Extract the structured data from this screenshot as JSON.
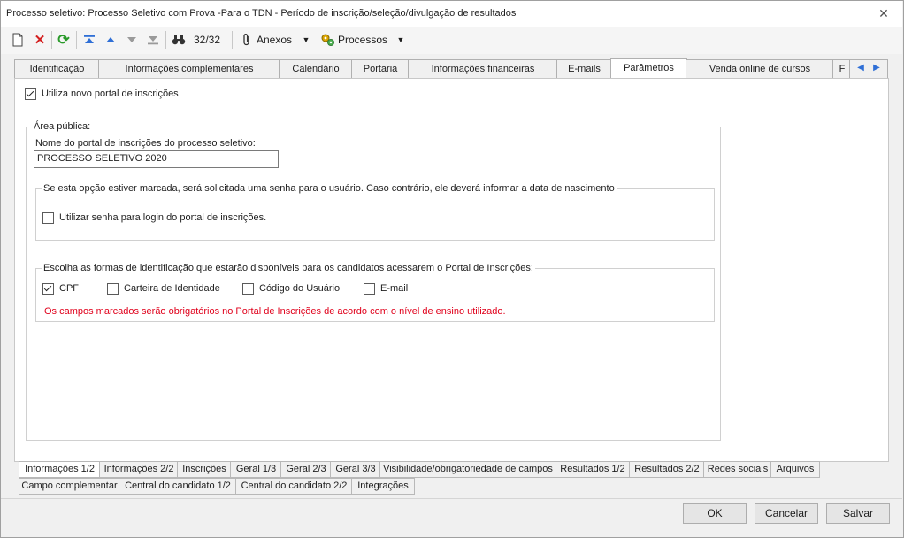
{
  "window": {
    "title": "Processo seletivo: Processo Seletivo com Prova -Para o TDN - Período de inscrição/seleção/divulgação de resultados",
    "close_icon": "close-icon"
  },
  "toolbar": {
    "record_counter": "32/32",
    "attachments_label": "Anexos",
    "processes_label": "Processos"
  },
  "top_tabs": [
    "Identificação",
    "Informações complementares",
    "Calendário",
    "Portaria",
    "Informações financeiras",
    "E-mails",
    "Parâmetros",
    "Venda online de cursos",
    "F"
  ],
  "content": {
    "use_new_portal_label": "Utiliza novo portal de inscrições",
    "public_area_legend": "Área pública:",
    "portal_name_label": "Nome do portal de inscrições do processo seletivo:",
    "portal_name_value": "PROCESSO SELETIVO 2020",
    "password_group_legend": "Se esta opção estiver marcada, será solicitada uma senha para o usuário. Caso contrário, ele deverá informar a data de nascimento",
    "use_password_label": "Utilizar senha para login do portal de inscrições.",
    "id_group_legend": "Escolha as formas de identificação que estarão disponíveis para os candidatos acessarem o Portal de Inscrições:",
    "id_options": [
      "CPF",
      "Carteira de Identidade",
      "Código do Usuário",
      "E-mail"
    ],
    "warning": "Os campos marcados serão obrigatórios no Portal de Inscrições de acordo com o nível de ensino utilizado.",
    "warning_color": "#e0001b"
  },
  "bottom_tabs_row1": [
    "Informações 1/2",
    "Informações 2/2",
    "Inscrições",
    "Geral 1/3",
    "Geral 2/3",
    "Geral 3/3",
    "Visibilidade/obrigatoriedade de campos",
    "Resultados 1/2",
    "Resultados 2/2",
    "Redes sociais",
    "Arquivos"
  ],
  "bottom_tabs_row2": [
    "Campo complementar",
    "Central do candidato 1/2",
    "Central do candidato 2/2",
    "Integrações"
  ],
  "buttons": {
    "ok": "OK",
    "cancel": "Cancelar",
    "save": "Salvar"
  }
}
